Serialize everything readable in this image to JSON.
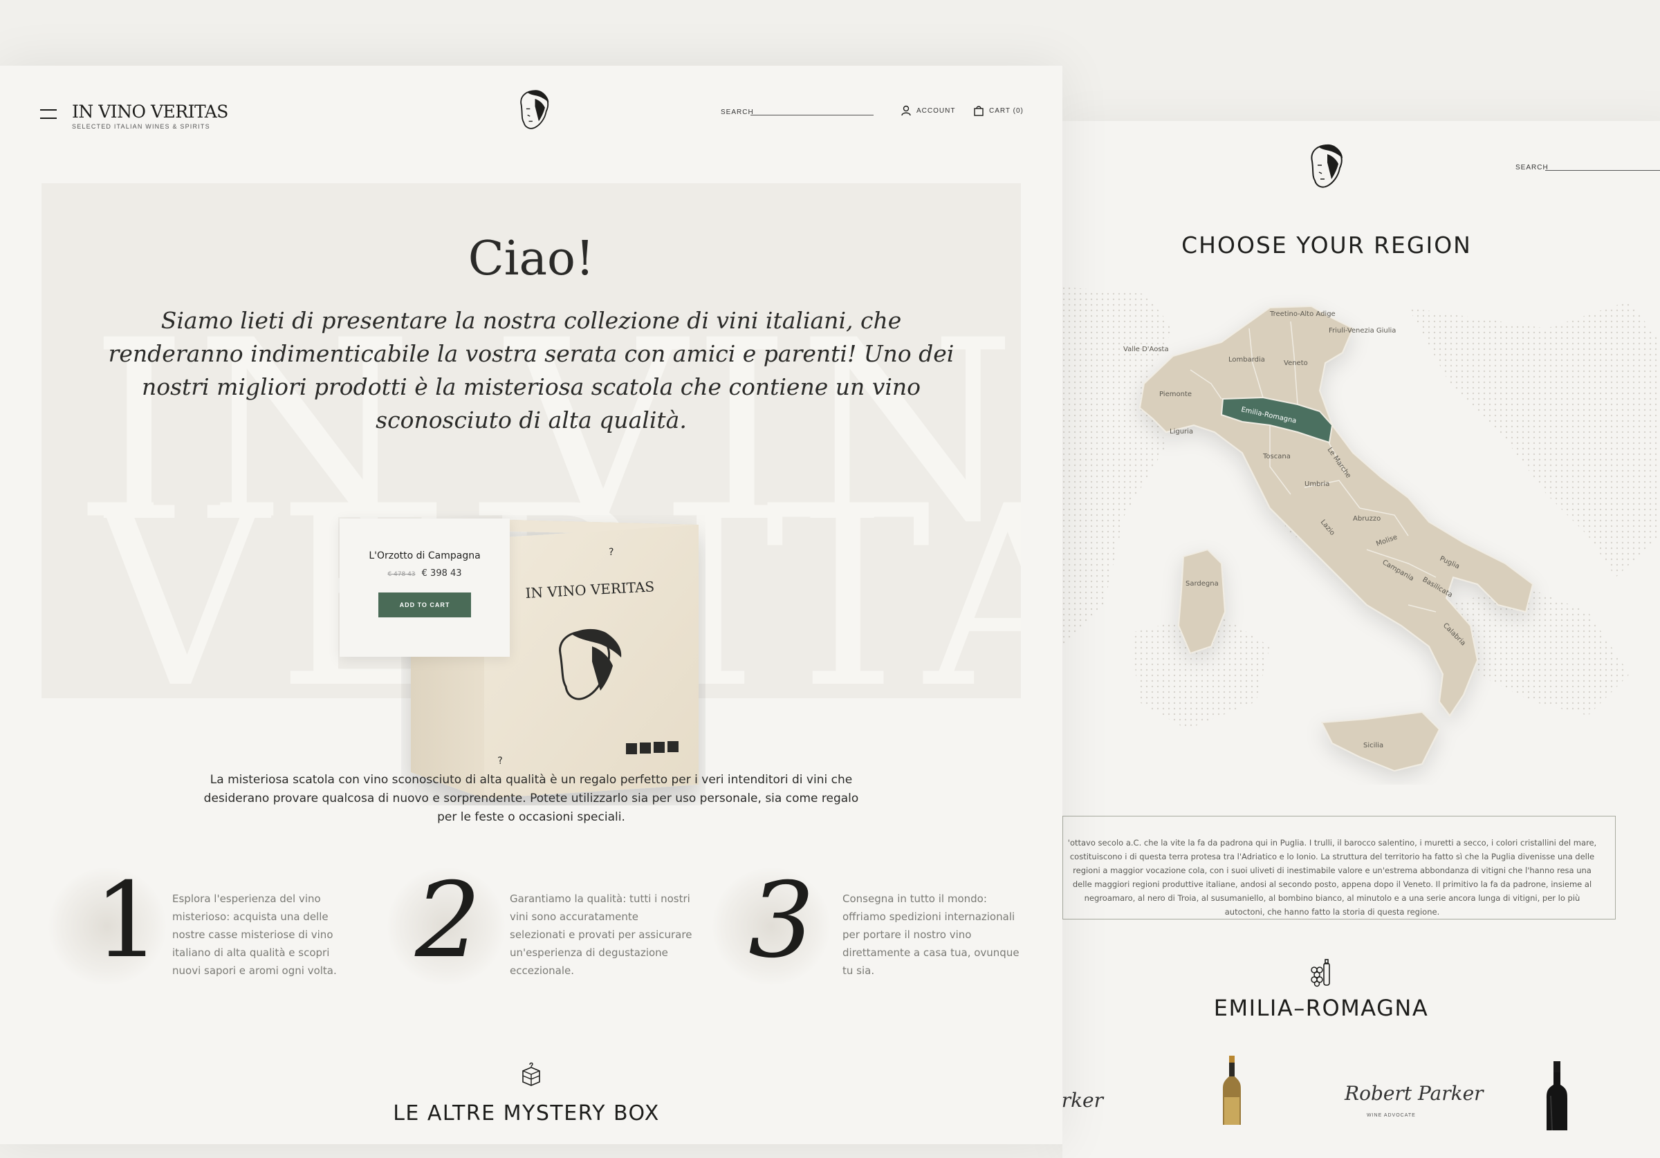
{
  "header": {
    "brand": "IN VINO VERITAS",
    "tagline": "SELECTED ITALIAN WINES & SPIRITS",
    "search_label": "SEARCH",
    "account_label": "ACCOUNT",
    "cart_label": "CART (0)"
  },
  "hero": {
    "title": "Ciao!",
    "text": "Siamo lieti di presentare la nostra collezione di vini italiani, che renderanno indimenticabile la vostra serata con amici e parenti! Uno dei nostri migliori prodotti è la misteriosa scatola che contiene un vino sconosciuto di alta qualità.",
    "watermark_line1": "IN VINO",
    "watermark_line2": "VERITAS"
  },
  "product": {
    "name": "L'Orzotto di Campagna",
    "old_price": "€ 478 43",
    "price": "€ 398 43",
    "cta": "ADD TO CART",
    "box_brand": "IN VINO VERITAS"
  },
  "description": "La misteriosa scatola con vino sconosciuto di alta qualità è un regalo perfetto per i veri intenditori di vini che desiderano provare qualcosa di nuovo e sorprendente. Potete utilizzarlo sia per uso personale, sia come regalo per le feste o occasioni speciali.",
  "steps": [
    {
      "num": "1",
      "text": "Esplora l'esperienza del vino misterioso: acquista una delle nostre casse misteriose di vino italiano di alta qualità e scopri nuovi sapori e aromi ogni volta."
    },
    {
      "num": "2",
      "text": "Garantiamo la qualità: tutti i nostri vini sono accuratamente selezionati e provati per assicurare un'esperienza di degustazione eccezionale."
    },
    {
      "num": "3",
      "text": "Consegna in tutto il mondo: offriamo spedizioni internazionali per portare il nostro vino direttamente a casa tua, ovunque tu sia."
    }
  ],
  "other_boxes_title": "LE ALTRE MYSTERY BOX",
  "region_page": {
    "search_label": "SEARCH",
    "title": "CHOOSE YOUR REGION",
    "selected_region": "Emilia-Romagna",
    "regions": [
      "Treetino-Alto Adige",
      "Friuli-Venezia Giulia",
      "Valle D'Aosta",
      "Lombardia",
      "Veneto",
      "Piemonte",
      "Emilia-Romagna",
      "Liguria",
      "Toscana",
      "Le Marche",
      "Umbria",
      "Abruzzo",
      "Lazio",
      "Molise",
      "Puglia",
      "Campania",
      "Basilicata",
      "Sardegna",
      "Calabria",
      "Sicilia"
    ],
    "region_text": "'ottavo secolo a.C. che la vite la fa da padrona qui in Puglia. I trulli, il barocco salentino, i muretti a secco, i colori cristallini del mare, costituiscono i di questa terra protesa tra l'Adriatico e lo Ionio. La struttura del territorio ha fatto sì che la Puglia divenisse una delle regioni a maggior vocazione cola, con i suoi uliveti di inestimabile valore e un'estrema abbondanza di vitigni che l'hanno resa una delle maggiori regioni produttive italiane, andosi al secondo posto, appena dopo il Veneto. Il primitivo la fa da padrone, insieme al negroamaro, al nero di Troia, al susumaniello, al bombino bianco, al minutolo e a una serie ancora lunga di vitigni, per lo più autoctoni, che hanno fatto la storia di questa regione.",
    "region_name": "EMILIA–ROMAGNA",
    "signature": "Robert Parker",
    "signature_caption": "WINE ADVOCATE"
  },
  "colors": {
    "accent_green": "#4a6b57",
    "map_land": "#d9cfbc",
    "map_selected": "#4c7060",
    "background": "#f6f5f2"
  }
}
